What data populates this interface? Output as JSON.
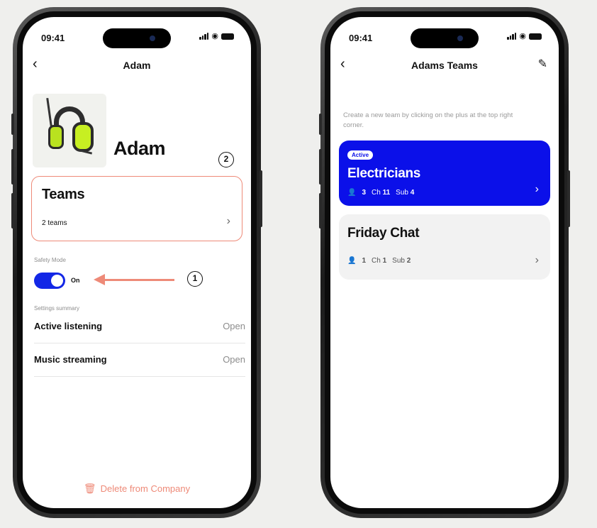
{
  "left_phone": {
    "status": {
      "time": "09:41"
    },
    "nav": {
      "back": "‹",
      "title": "Adam"
    },
    "profile": {
      "name": "Adam"
    },
    "callouts": {
      "one": "1",
      "two": "2"
    },
    "teams_card": {
      "title": "Teams",
      "subtitle": "2 teams",
      "chevron": "›"
    },
    "safety": {
      "label": "Safety Mode",
      "toggle_state": "On",
      "enabled": true
    },
    "settings_summary": {
      "label": "Settings summary",
      "rows": [
        {
          "label": "Active listening",
          "value": "Open"
        },
        {
          "label": "Music streaming",
          "value": "Open"
        }
      ]
    },
    "delete": {
      "label": "Delete from Company",
      "icon": "trash-icon"
    }
  },
  "right_phone": {
    "status": {
      "time": "09:41"
    },
    "nav": {
      "back": "‹",
      "title": "Adams Teams",
      "edit_icon": "pencil-icon"
    },
    "hint": "Create a new team by clicking on the plus at the top right corner.",
    "teams": [
      {
        "badge": "Active",
        "name": "Electricians",
        "members": "3",
        "ch_label": "Ch",
        "ch_value": "11",
        "sub_label": "Sub",
        "sub_value": "4",
        "chevron": "›"
      },
      {
        "name": "Friday Chat",
        "members": "1",
        "ch_label": "Ch",
        "ch_value": "1",
        "sub_label": "Sub",
        "sub_value": "2",
        "chevron": "›"
      }
    ]
  },
  "colors": {
    "accent_blue": "#0b10e9",
    "highlight_salmon": "#ee8a78",
    "toggle_blue": "#1327e6",
    "headset_green": "#c7ef22"
  }
}
